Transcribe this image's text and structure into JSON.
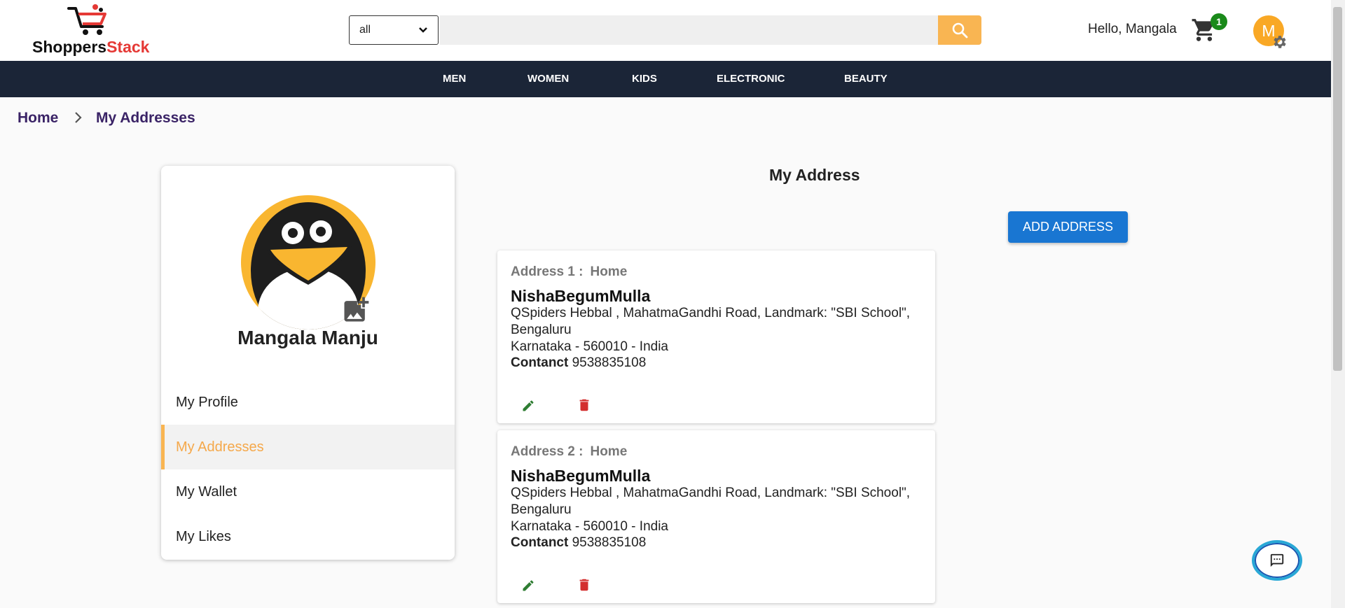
{
  "header": {
    "logo_part1": "Shoppers",
    "logo_part2": "Stack",
    "category_value": "all",
    "search_placeholder": "",
    "greeting": "Hello, Mangala",
    "cart_count": "1",
    "avatar_letter": "M"
  },
  "nav": {
    "items": [
      "MEN",
      "WOMEN",
      "KIDS",
      "ELECTRONIC",
      "BEAUTY"
    ]
  },
  "breadcrumb": {
    "home": "Home",
    "current": "My Addresses"
  },
  "sidebar": {
    "profile_name": "Mangala Manju",
    "menu": [
      "My Profile",
      "My Addresses",
      "My Wallet",
      "My Likes"
    ],
    "active": "My Addresses"
  },
  "main": {
    "title": "My Address",
    "add_button": "ADD ADDRESS",
    "addresses": [
      {
        "label": "Address 1 :",
        "type": "Home",
        "name": "NishaBegumMulla",
        "line1": "QSpiders Hebbal , MahatmaGandhi Road, Landmark: \"SBI School\", Bengaluru",
        "line2": "Karnataka - 560010 - India",
        "contact_label": "Contanct",
        "contact_value": "9538835108"
      },
      {
        "label": "Address 2 :",
        "type": "Home",
        "name": "NishaBegumMulla",
        "line1": "QSpiders Hebbal , MahatmaGandhi Road, Landmark: \"SBI School\", Bengaluru",
        "line2": "Karnataka - 560010 - India",
        "contact_label": "Contanct",
        "contact_value": "9538835108"
      }
    ]
  },
  "colors": {
    "nav_bg": "#1b2537",
    "accent_orange": "#f9b552",
    "primary_blue": "#1976d2",
    "breadcrumb": "#3a2366",
    "cart_badge": "#1a8a1a",
    "delete_red": "#d32f2f",
    "edit_green": "#2e7d32"
  },
  "icons": [
    "cart-logo-icon",
    "chevron-down-icon",
    "search-icon",
    "cart-icon",
    "gear-icon",
    "chevron-right-icon",
    "penguin-avatar",
    "add-photo-icon",
    "edit-icon",
    "delete-icon",
    "chat-icon"
  ]
}
